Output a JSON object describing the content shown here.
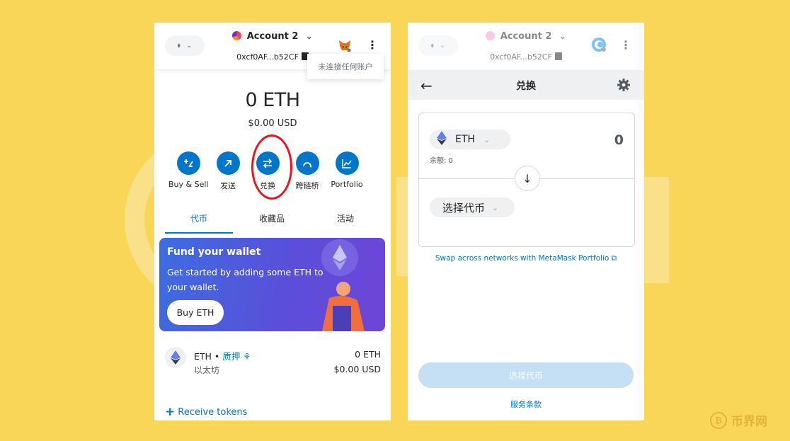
{
  "left_panel": {
    "account_name": "Account 2",
    "address": "0xcf0AF...b52CF",
    "tooltip": "未连接任何账户",
    "balance": "0 ETH",
    "balance_usd": "$0.00 USD",
    "actions": [
      {
        "label": "Buy & Sell",
        "icon": "plus-minus-icon"
      },
      {
        "label": "发送",
        "icon": "arrow-up-right-icon"
      },
      {
        "label": "兑换",
        "icon": "swap-arrows-icon"
      },
      {
        "label": "跨链桥",
        "icon": "bridge-icon"
      },
      {
        "label": "Portfolio",
        "icon": "chart-icon"
      }
    ],
    "tabs": [
      {
        "label": "代币",
        "active": true
      },
      {
        "label": "收藏品",
        "active": false
      },
      {
        "label": "活动",
        "active": false
      }
    ],
    "fund_card": {
      "title": "Fund your wallet",
      "text": "Get started by adding some ETH to your wallet.",
      "button": "Buy ETH"
    },
    "asset": {
      "name": "ETH",
      "stake_label": "质押",
      "subtitle": "以太坊",
      "amount": "0 ETH",
      "amount_usd": "$0.00 USD"
    },
    "receive_label": "Receive tokens"
  },
  "right_panel": {
    "account_name": "Account 2",
    "address": "0xcf0AF...b52CF",
    "title": "兑换",
    "from_token": "ETH",
    "balance_label": "余额: 0",
    "from_amount": "0",
    "to_token_placeholder": "选择代币",
    "portfolio_link": "Swap across networks with MetaMask Portfolio",
    "swap_button": "选择代币",
    "terms": "服务条款"
  },
  "watermark": "币界网",
  "colors": {
    "background": "#f9d558",
    "accent": "#0376c9",
    "highlight": "#e8151d",
    "fund_gradient_start": "#3d6de0",
    "fund_gradient_end": "#6e45d8"
  }
}
